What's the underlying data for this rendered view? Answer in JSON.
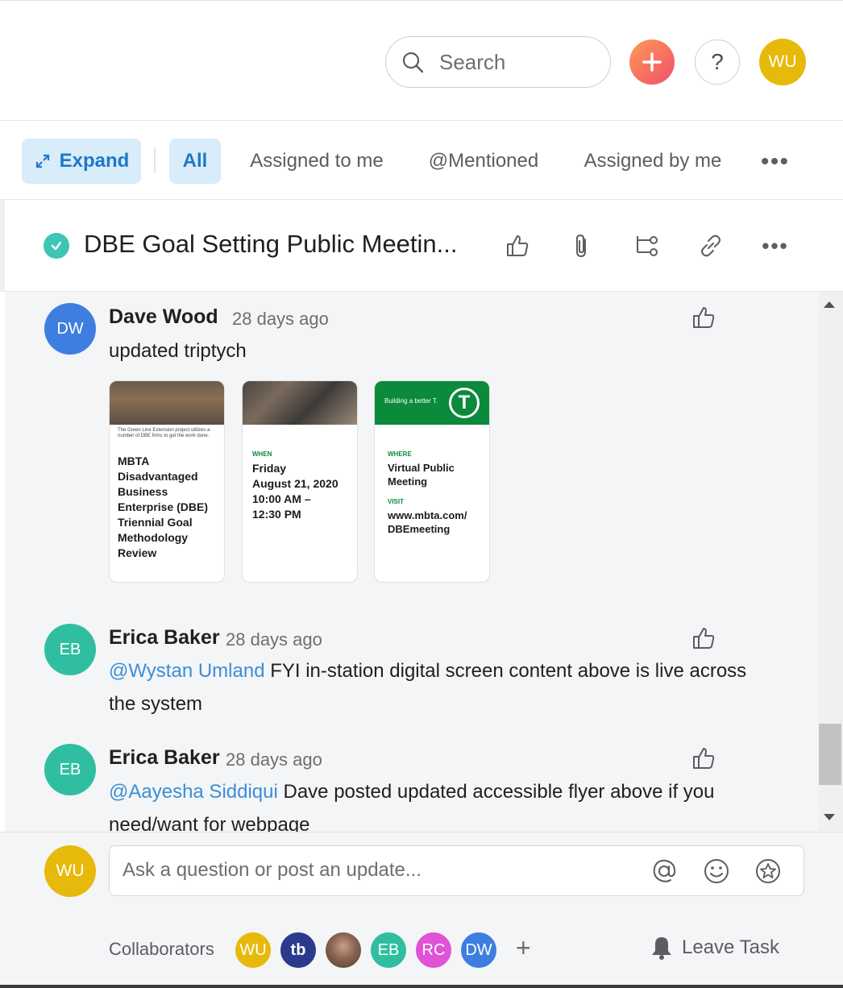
{
  "topbar": {
    "search_placeholder": "Search",
    "help_label": "?",
    "user_initials": "WU"
  },
  "filters": {
    "expand_label": "Expand",
    "tabs": [
      {
        "label": "All",
        "active": true
      },
      {
        "label": "Assigned to me",
        "active": false
      },
      {
        "label": "@Mentioned",
        "active": false
      },
      {
        "label": "Assigned by me",
        "active": false
      }
    ],
    "more_label": "•••"
  },
  "task": {
    "title": "DBE Goal Setting Public Meetin...",
    "more_label": "•••"
  },
  "comments": [
    {
      "initials": "DW",
      "author": "Dave Wood",
      "time": "28 days ago",
      "text": "updated triptych",
      "avatar_color": "#3d7ee0"
    },
    {
      "initials": "EB",
      "author": "Erica Baker",
      "time": "28 days ago",
      "mention": "@Wystan Umland",
      "text": " FYI in-station digital screen content above is live across the system",
      "avatar_color": "#2fbfa0"
    },
    {
      "initials": "EB",
      "author": "Erica Baker",
      "time": "28 days ago",
      "mention": "@Aayesha Siddiqui",
      "text": " Dave posted updated accessible flyer above if you need/want for webpage",
      "avatar_color": "#2fbfa0"
    }
  ],
  "attachments": {
    "card1": {
      "caption": "The Green Line Extension project utilizes a number of DBE firms to get the work done.",
      "heading_lines": [
        "MBTA",
        "Disadvantaged",
        "Business",
        "Enterprise (DBE)",
        "Triennial Goal",
        "Methodology",
        "Review"
      ]
    },
    "card2": {
      "when_label": "WHEN",
      "when_lines": [
        "Friday",
        "August 21, 2020",
        "10:00 AM –",
        "12:30 PM"
      ]
    },
    "card3": {
      "banner": "Building a better T.",
      "logo": "T",
      "where_label": "WHERE",
      "where_lines": [
        "Virtual Public",
        "Meeting"
      ],
      "visit_label": "VISIT",
      "visit_lines": [
        "www.mbta.com/",
        "DBEmeeting"
      ]
    }
  },
  "composer": {
    "placeholder": "Ask a question or post an update...",
    "me_initials": "WU"
  },
  "collaborators": {
    "label": "Collaborators",
    "people": [
      {
        "initials": "WU",
        "color": "#e7b90b"
      },
      {
        "initials": "tb",
        "color": "#2b3a8c"
      },
      {
        "initials": "",
        "color": "#7a5a48"
      },
      {
        "initials": "EB",
        "color": "#2fbfa0"
      },
      {
        "initials": "RC",
        "color": "#e052d6"
      },
      {
        "initials": "DW",
        "color": "#3d7ee0"
      }
    ],
    "add_label": "+",
    "leave_label": "Leave Task"
  }
}
